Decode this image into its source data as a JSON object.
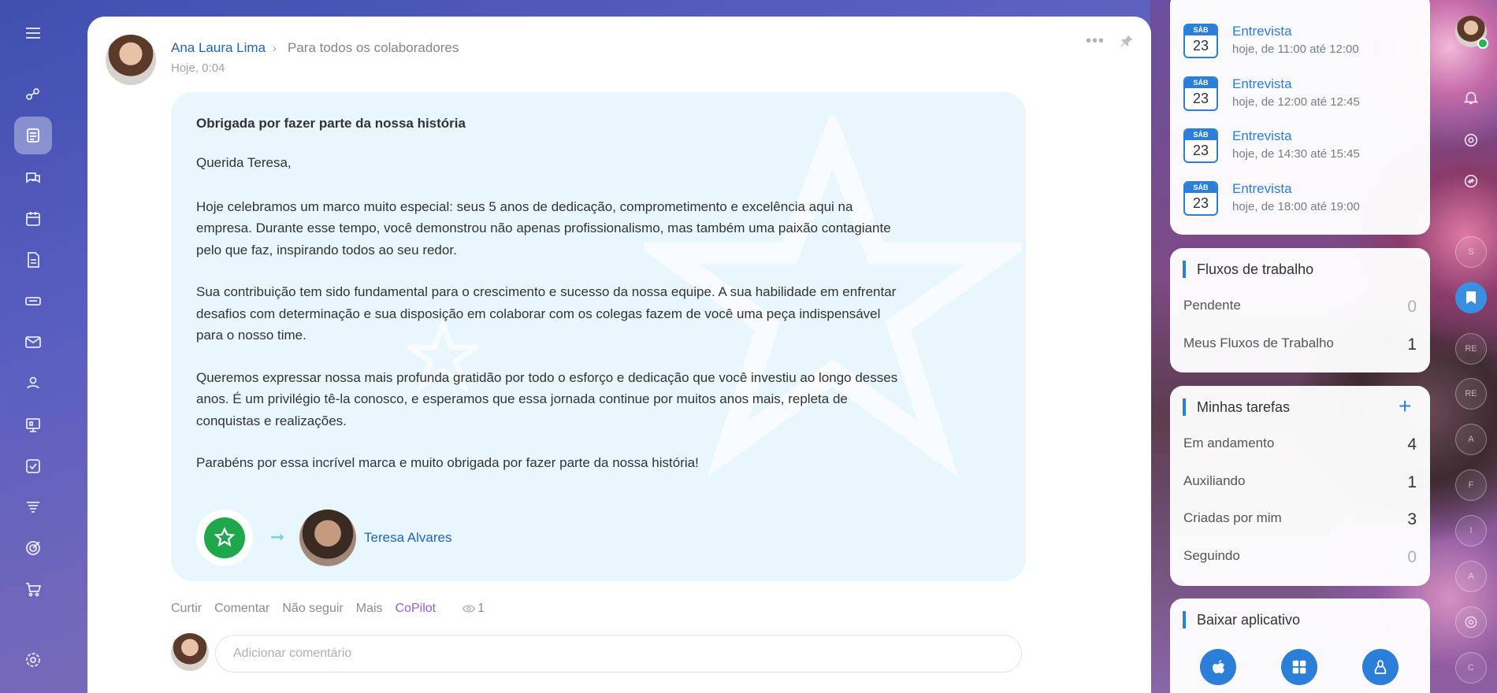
{
  "post": {
    "author": "Ana Laura Lima",
    "audience": "Para todos os colaboradores",
    "time": "Hoje, 0:04",
    "title": "Obrigada por fazer parte da nossa história",
    "greeting": "Querida Teresa,",
    "paragraphs": [
      "Hoje celebramos um marco muito especial: seus 5 anos de dedicação, comprometimento e excelência aqui na empresa. Durante esse tempo, você demonstrou não apenas profissionalismo, mas também uma paixão contagiante pelo que faz, inspirando todos ao seu redor.",
      "Sua contribuição tem sido fundamental para o crescimento e sucesso da nossa equipe. A sua habilidade em enfrentar desafios com determinação e sua disposição em colaborar com os colegas fazem de você uma peça indispensável para o nosso time.",
      "Queremos expressar nossa mais profunda gratidão por todo o esforço e dedicação que você investiu ao longo desses anos. É um privilégio tê-la conosco, e esperamos que essa jornada continue por muitos anos mais, repleta de conquistas e realizações.",
      "Parabéns por essa incrível marca e muito obrigada por fazer parte da nossa história!"
    ],
    "recipient": "Teresa Alvares",
    "actions": {
      "like": "Curtir",
      "comment": "Comentar",
      "unfollow": "Não seguir",
      "more": "Mais",
      "copilot": "CoPilot",
      "views": "1"
    },
    "comment_placeholder": "Adicionar comentário"
  },
  "events": [
    {
      "weekday": "SÁB",
      "day": "23",
      "title": "Entrevista",
      "time": "hoje, de 11:00 até 12:00"
    },
    {
      "weekday": "SÁB",
      "day": "23",
      "title": "Entrevista",
      "time": "hoje, de 12:00 até 12:45"
    },
    {
      "weekday": "SÁB",
      "day": "23",
      "title": "Entrevista",
      "time": "hoje, de 14:30 até 15:45"
    },
    {
      "weekday": "SÁB",
      "day": "23",
      "title": "Entrevista",
      "time": "hoje, de 18:00 até 19:00"
    }
  ],
  "workflows": {
    "title": "Fluxos de trabalho",
    "rows": [
      {
        "label": "Pendente",
        "value": "0"
      },
      {
        "label": "Meus Fluxos de Trabalho",
        "value": "1"
      }
    ]
  },
  "tasks": {
    "title": "Minhas tarefas",
    "rows": [
      {
        "label": "Em andamento",
        "value": "4"
      },
      {
        "label": "Auxiliando",
        "value": "1"
      },
      {
        "label": "Criadas por mim",
        "value": "3"
      },
      {
        "label": "Seguindo",
        "value": "0"
      }
    ]
  },
  "download": {
    "title": "Baixar aplicativo",
    "apps": [
      "apple-icon",
      "windows-icon",
      "linux-icon"
    ]
  },
  "right_bar": {
    "items": [
      "S",
      "RE",
      "RE",
      "A",
      "F",
      "I",
      "A",
      "C"
    ]
  },
  "colors": {
    "accent": "#2b7fd8",
    "link": "#2067b0",
    "badge_green": "#21a74b",
    "copilot": "#9b5ad8",
    "message_bg": "#e8f6fd"
  }
}
